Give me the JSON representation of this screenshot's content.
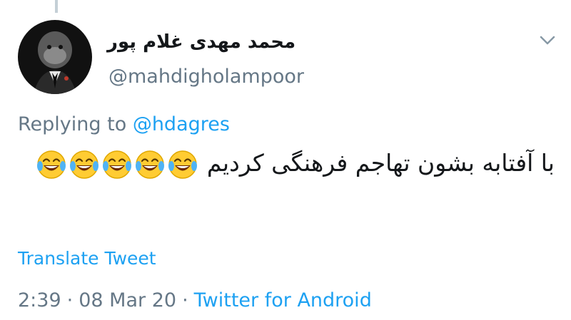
{
  "tweet": {
    "display_name": "محمد مهدی غلام پور",
    "handle": "@mahdigholampoor",
    "replying_prefix": "Replying to",
    "replying_to": "@hdagres",
    "text": "با آفتابه بشون تهاجم فرهنگی کردیم",
    "emojis": [
      "face-with-tears-of-joy-icon",
      "face-with-tears-of-joy-icon",
      "face-with-tears-of-joy-icon",
      "face-with-tears-of-joy-icon",
      "face-with-tears-of-joy-icon"
    ],
    "translate_label": "Translate Tweet",
    "time": "2:39",
    "separator": "·",
    "date": "08 Mar 20",
    "source": "Twitter for Android"
  },
  "colors": {
    "link": "#1da1f2",
    "secondary_text": "#657786",
    "primary_text": "#14171a",
    "thread_line": "#c4cfd6"
  }
}
